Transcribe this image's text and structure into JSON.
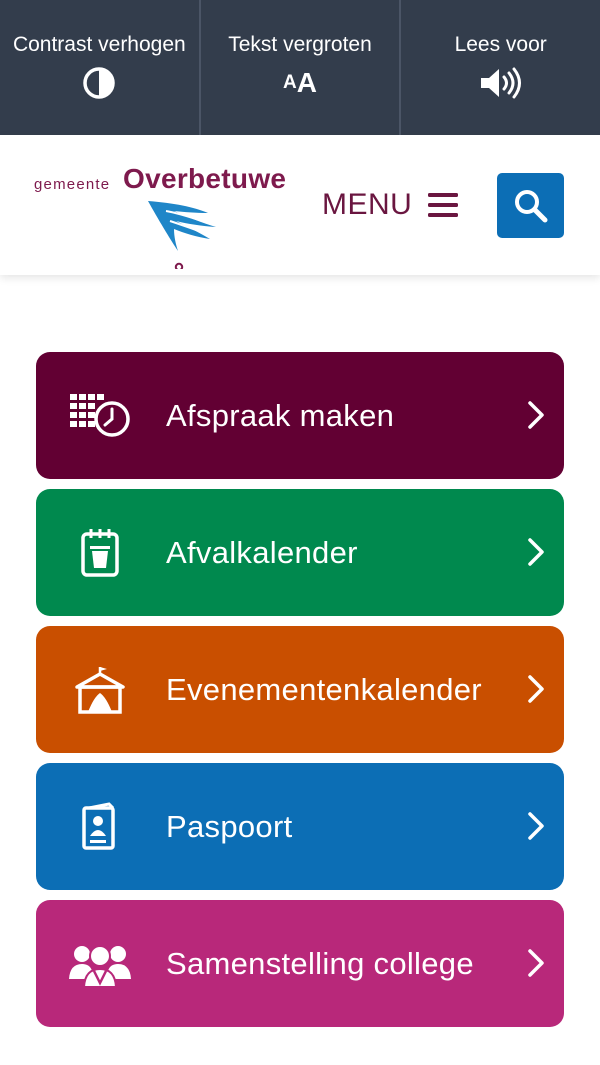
{
  "accessibility_bar": {
    "contrast": {
      "label": "Contrast verhogen",
      "icon": "contrast-icon"
    },
    "text_size": {
      "label": "Tekst vergroten",
      "icon_small": "A",
      "icon_big": "A"
    },
    "read_aloud": {
      "label": "Lees voor",
      "icon": "speaker-icon"
    },
    "background_color": "#333d4c"
  },
  "header": {
    "logo_small": "gemeente",
    "logo_big": "Overbetuwe",
    "menu_label": "MENU",
    "menu_icon": "hamburger-icon",
    "search_icon": "search-icon",
    "brand_color": "#7e1a4d",
    "search_color": "#0c6eb5"
  },
  "tiles": [
    {
      "label": "Afspraak maken",
      "icon": "calendar-clock-icon",
      "color": "#620033"
    },
    {
      "label": "Afvalkalender",
      "icon": "waste-calendar-icon",
      "color": "#00894e"
    },
    {
      "label": "Evenementenkalender",
      "icon": "tent-icon",
      "color": "#c94f00"
    },
    {
      "label": "Paspoort",
      "icon": "passport-icon",
      "color": "#0c6eb5"
    },
    {
      "label": "Samenstelling college",
      "icon": "people-group-icon",
      "color": "#b8287a"
    }
  ]
}
